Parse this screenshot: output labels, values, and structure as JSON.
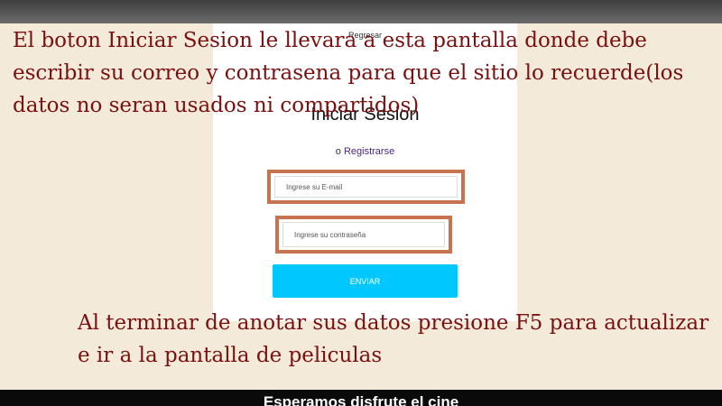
{
  "login": {
    "back_link": "Regresar",
    "title": "Iniciar Sesion",
    "register_prefix": "o",
    "register_link": "Registrarse",
    "email_placeholder": "Ingrese su E-mail",
    "password_placeholder": "Ingrese su contraseña",
    "submit_label": "ENVIAR"
  },
  "annotations": {
    "top_text": "El boton Iniciar Sesion le llevara a esta pantalla donde debe escribir su correo y contrasena para que el sitio lo recuerde(los datos no seran usados ni compartidos)",
    "bottom_text": "Al terminar de anotar sus datos presione F5 para actualizar e ir a la pantalla de peliculas",
    "highlight_color": "#c87350",
    "text_color": "#7a1010"
  },
  "bottom_bar": {
    "caption": "Esperamos disfrute el cine"
  }
}
